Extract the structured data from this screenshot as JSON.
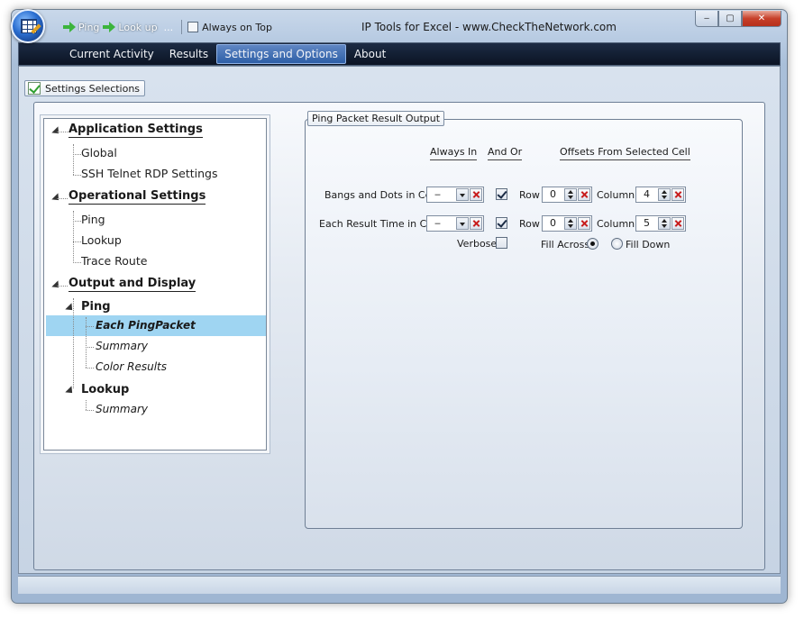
{
  "window": {
    "title": "IP Tools for Excel - www.CheckTheNetwork.com",
    "controls": {
      "minimize": "‒",
      "maximize": "▢",
      "close": "✕"
    }
  },
  "quick_access": {
    "ping_label": "Ping",
    "lookup_label": "Look up",
    "ellipsis": "...",
    "always_on_top_label": "Always on Top",
    "always_on_top_checked": false
  },
  "menu": {
    "items": [
      "Current Activity",
      "Results",
      "Settings and Options",
      "About"
    ],
    "active": "Settings and Options"
  },
  "section_tab": {
    "label": "Settings Selections"
  },
  "tree": {
    "application_settings": "Application Settings",
    "global": "Global",
    "ssh_telnet_rdp": "SSH  Telnet  RDP Settings",
    "operational_settings": "Operational Settings",
    "ping": "Ping",
    "lookup": "Lookup",
    "trace_route": "Trace Route",
    "output_and_display": "Output and Display",
    "out_ping": "Ping",
    "each_ping_packet": "Each PingPacket",
    "ping_summary": "Summary",
    "color_results": "Color Results",
    "out_lookup": "Lookup",
    "lookup_summary": "Summary",
    "selected": "Each PingPacket"
  },
  "group": {
    "title": "Ping Packet Result Output",
    "headers": {
      "always_in": "Always In",
      "and_or": "And Or",
      "offsets": "Offsets From Selected Cell"
    },
    "rows": [
      {
        "label": "Bangs and Dots in Cell",
        "always_in": "‒",
        "and_or_checked": true,
        "row_label": "Row",
        "row_value": "0",
        "column_label": "Column",
        "column_value": "4"
      },
      {
        "label": "Each Result Time in Cell",
        "always_in": "‒",
        "and_or_checked": true,
        "row_label": "Row",
        "row_value": "0",
        "column_label": "Column",
        "column_value": "5"
      }
    ],
    "verbose_label": "Verbose",
    "verbose_checked": false,
    "fill_across_label": "Fill Across",
    "fill_down_label": "Fill Down",
    "fill_selected": "Fill Across"
  }
}
